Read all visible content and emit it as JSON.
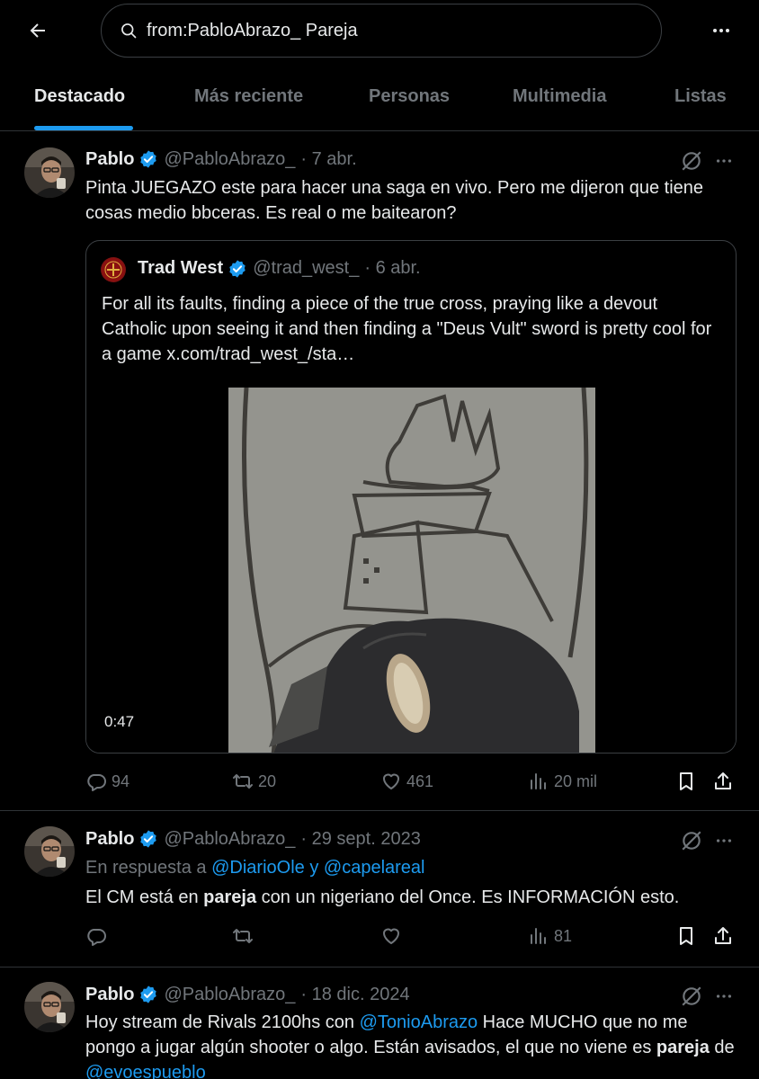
{
  "search": {
    "query": "from:PabloAbrazo_ Pareja"
  },
  "tabs": [
    "Destacado",
    "Más reciente",
    "Personas",
    "Multimedia",
    "Listas"
  ],
  "tweets": [
    {
      "name": "Pablo",
      "handle": "@PabloAbrazo_",
      "date": "· 7 abr.",
      "text": "Pinta JUEGAZO este para hacer una saga en vivo. Pero me dijeron que tiene cosas medio bbceras. Es real o me baitearon?",
      "quote": {
        "name": "Trad West",
        "handle": "@trad_west_",
        "date": "· 6 abr.",
        "text": "For all its faults, finding a piece of the true cross, praying like a devout Catholic upon seeing it and then finding a \"Deus Vult\" sword is pretty cool for a game",
        "link": "x.com/trad_west_/sta…",
        "video_duration": "0:47"
      },
      "replies": "94",
      "retweets": "20",
      "likes": "461",
      "views": "20 mil"
    },
    {
      "name": "Pablo",
      "handle": "@PabloAbrazo_",
      "date": "· 29 sept. 2023",
      "reply_prefix": "En respuesta a",
      "reply_to_1": "@DiarioOle",
      "reply_and": "y",
      "reply_to_2": "@capelareal",
      "text_before": "El CM está en",
      "text_bold": "pareja",
      "text_after": "con un nigeriano del Once. Es INFORMACIÓN esto.",
      "views": "81"
    },
    {
      "name": "Pablo",
      "handle": "@PabloAbrazo_",
      "date": "· 18 dic. 2024",
      "text_1": "Hoy stream de Rivals 2100hs con",
      "mention_1": "@TonioAbrazo",
      "text_2": "Hace MUCHO que no me pongo a jugar algún shooter o algo. Están avisados, el que no viene es",
      "text_bold": "pareja",
      "text_3": "de",
      "mention_2": "@evoespueblo"
    }
  ],
  "colors": {
    "accent": "#1d9bf0",
    "muted": "#71767b",
    "text": "#e7e9ea",
    "border": "#2f3336",
    "background": "#000000"
  }
}
